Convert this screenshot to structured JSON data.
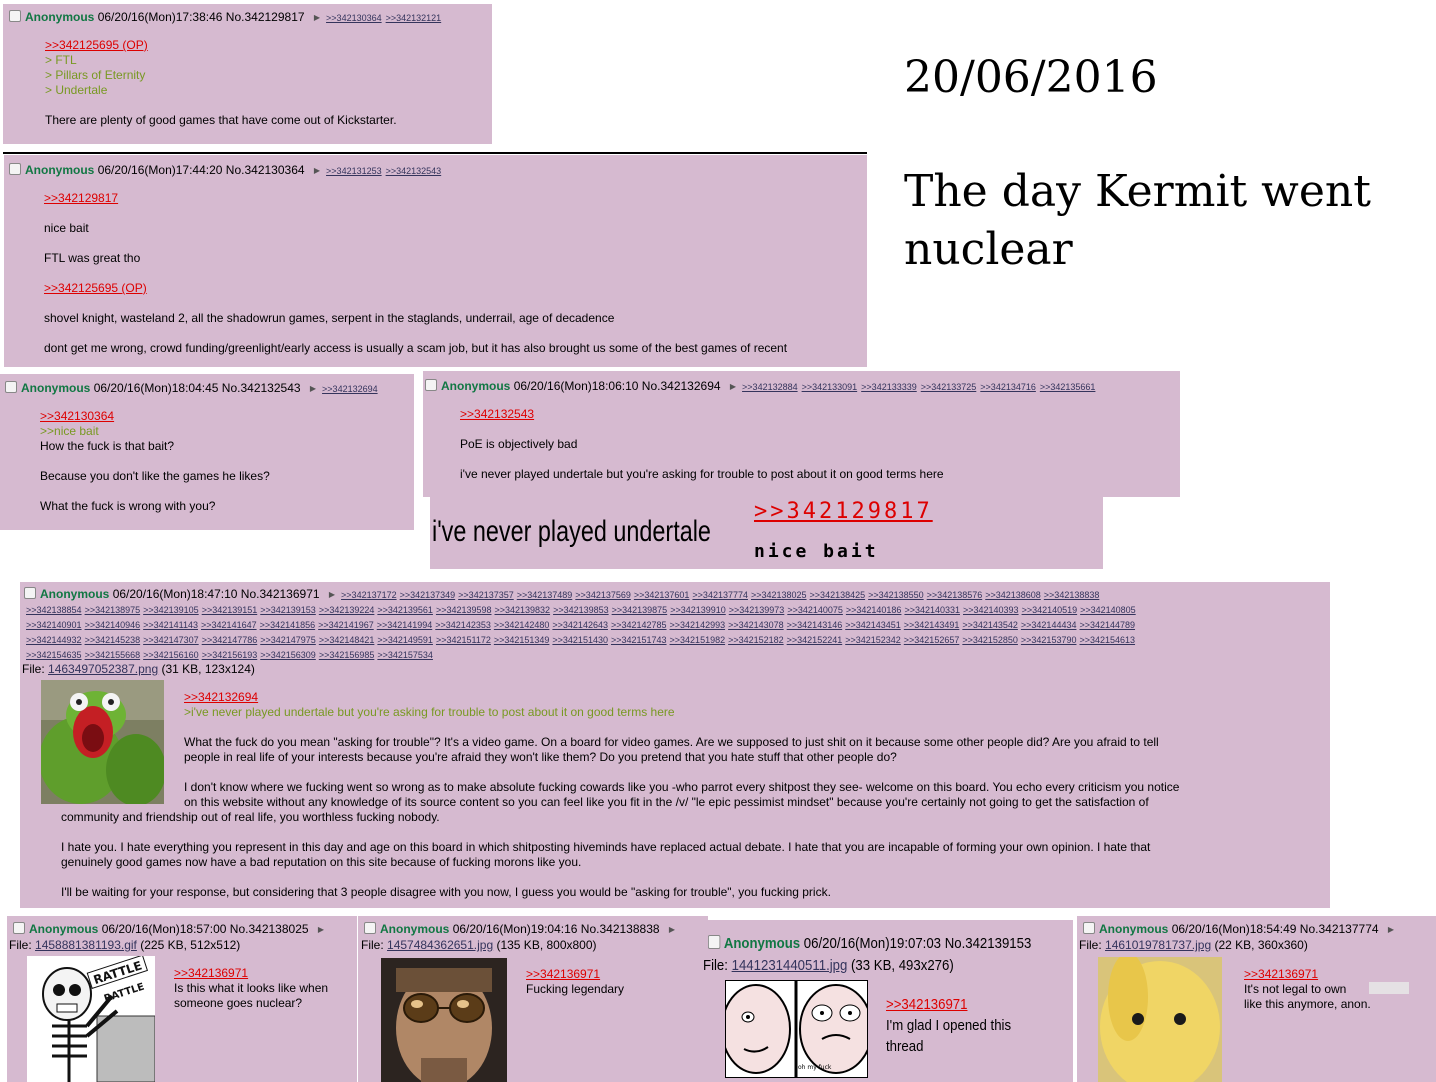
{
  "date_heading": "20/06/2016",
  "title_line1": "The day Kermit went",
  "title_line2": "nuclear",
  "post1": {
    "name": "Anonymous",
    "date": "06/20/16(Mon)17:38:46",
    "no": "No.342129817",
    "backlinks": [
      ">>342130364",
      ">>342132121"
    ],
    "quote": ">>342125695 (OP)",
    "green": [
      "> FTL",
      "> Pillars of Eternity",
      "> Undertale"
    ],
    "text": "There are plenty of good games that have come out of Kickstarter."
  },
  "post2": {
    "name": "Anonymous",
    "date": "06/20/16(Mon)17:44:20",
    "no": "No.342130364",
    "backlinks": [
      ">>342131253",
      ">>342132543"
    ],
    "quote1": ">>342129817",
    "line1": "nice bait",
    "line2": "FTL was great tho",
    "quote2": ">>342125695 (OP)",
    "line3": "shovel knight, wasteland 2, all the shadowrun games, serpent in the staglands, underrail, age of decadence",
    "line4": "dont get me wrong, crowd funding/greenlight/early access is usually a scam job, but it has also brought us some of the best games of recent"
  },
  "post3": {
    "name": "Anonymous",
    "date": "06/20/16(Mon)18:04:45",
    "no": "No.342132543",
    "backlinks": [
      ">>342132694"
    ],
    "quote": ">>342130364",
    "green": ">>nice bait",
    "line1": "How the fuck is that bait?",
    "line2": "Because you don't like the games he likes?",
    "line3": "What the fuck is wrong with you?"
  },
  "post4": {
    "name": "Anonymous",
    "date": "06/20/16(Mon)18:06:10",
    "no": "No.342132694",
    "backlinks": [
      ">>342132884",
      ">>342133091",
      ">>342133339",
      ">>342133725",
      ">>342134716",
      ">>342135661"
    ],
    "quote": ">>342132543",
    "line1": "PoE is objectively bad",
    "line2": "i've never played undertale but you're asking for trouble to post about it on good terms here"
  },
  "crop": {
    "text": "i've never played undertale",
    "quote": ">>342129817",
    "bait": "nice bait"
  },
  "post5": {
    "name": "Anonymous",
    "date": "06/20/16(Mon)18:47:10",
    "no": "No.342136971",
    "refs_row1": [
      ">>342137172",
      ">>342137349",
      ">>342137357",
      ">>342137489",
      ">>342137569",
      ">>342137601",
      ">>342137774",
      ">>342138025",
      ">>342138425",
      ">>342138550",
      ">>342138576",
      ">>342138608",
      ">>342138838"
    ],
    "refs_row2": [
      ">>342138854",
      ">>342138975",
      ">>342139105",
      ">>342139151",
      ">>342139153",
      ">>342139224",
      ">>342139561",
      ">>342139598",
      ">>342139832",
      ">>342139853",
      ">>342139875",
      ">>342139910",
      ">>342139973",
      ">>342140075",
      ">>342140186",
      ">>342140331",
      ">>342140393",
      ">>342140519",
      ">>342140805"
    ],
    "refs_row3": [
      ">>342140901",
      ">>342140946",
      ">>342141143",
      ">>342141647",
      ">>342141856",
      ">>342141967",
      ">>342141994",
      ">>342142353",
      ">>342142480",
      ">>342142643",
      ">>342142785",
      ">>342142993",
      ">>342143078",
      ">>342143146",
      ">>342143451",
      ">>342143491",
      ">>342143542",
      ">>342144434",
      ">>342144789"
    ],
    "refs_row4": [
      ">>342144932",
      ">>342145238",
      ">>342147307",
      ">>342147786",
      ">>342147975",
      ">>342148421",
      ">>342149591",
      ">>342151172",
      ">>342151349",
      ">>342151430",
      ">>342151743",
      ">>342151982",
      ">>342152182",
      ">>342152241",
      ">>342152342",
      ">>342152657",
      ">>342152850",
      ">>342153790",
      ">>342154613"
    ],
    "refs_row5": [
      ">>342154635",
      ">>342155668",
      ">>342156160",
      ">>342156193",
      ">>342156309",
      ">>342156985",
      ">>342157534"
    ],
    "file_label": "File: ",
    "file_name": "1463497052387.png",
    "file_info": " (31 KB, 123x124)",
    "quote": ">>342132694",
    "green": ">i've never played undertale but you're asking for trouble to post about it on good terms here",
    "p1a": "What the fuck do you mean \"asking for trouble\"? It's a video game. On a board for video games. Are we supposed to just shit on it because some other people did? Are you afraid to tell",
    "p1b": "people in real life of your interests because you're afraid they won't like them? Do you pretend that you hate stuff that other people do?",
    "p2a": "I don't know where we fucking went so wrong as to make absolute fucking cowards like you -who parrot every shitpost they see- welcome on this board. You echo every criticism you notice",
    "p2b": "on this website without any knowledge of its source content so you can feel like you fit in the /v/ \"le epic pessimist mindset\" because you're certainly not going to get the satisfaction of",
    "p2c": "community and friendship out of real life, you worthless fucking nobody.",
    "p3a": "I hate you. I hate everything you represent in this day and age on this board in which shitposting hiveminds have replaced actual debate. I hate that you are incapable of forming your own opinion. I hate that",
    "p3b": "genuinely good games now have a bad reputation on this site because of fucking morons like you.",
    "p4": "I'll be waiting for your response, but considering that 3 people disagree with you now, I guess you would be \"asking for trouble\", you fucking prick."
  },
  "post6": {
    "name": "Anonymous",
    "date": "06/20/16(Mon)18:57:00",
    "no": "No.342138025",
    "file_label": "File: ",
    "file_name": "1458881381193.gif",
    "file_info": " (225 KB, 512x512)",
    "rattle1": "RATTLE",
    "rattle2": "RATTLE",
    "quote": ">>342136971",
    "line1": "Is this what it looks like when",
    "line2": "someone goes nuclear?"
  },
  "post7": {
    "name": "Anonymous",
    "date": "06/20/16(Mon)19:04:16",
    "no": "No.342138838",
    "file_label": "File: ",
    "file_name": "1457484362651.jpg",
    "file_info": " (135 KB, 800x800)",
    "quote": ">>342136971",
    "line1": "Fucking legendary"
  },
  "post8": {
    "name": "Anonymous",
    "date": "06/20/16(Mon)19:07:03",
    "no": "No.342139153",
    "file_label": "File: ",
    "file_name": "1441231440511.jpg",
    "file_info": " (33 KB, 493x276)",
    "quote": ">>342136971",
    "line1": "I'm glad I opened this",
    "line2": "thread",
    "caption": "oh my fuck"
  },
  "post9": {
    "name": "Anonymous",
    "date": "06/20/16(Mon)18:54:49",
    "no": "No.342137774",
    "file_label": "File: ",
    "file_name": "1461019781737.jpg",
    "file_info": " (22 KB, 360x360)",
    "quote": ">>342136971",
    "line1": "It's not legal to own",
    "line2": "like this anymore, anon."
  }
}
